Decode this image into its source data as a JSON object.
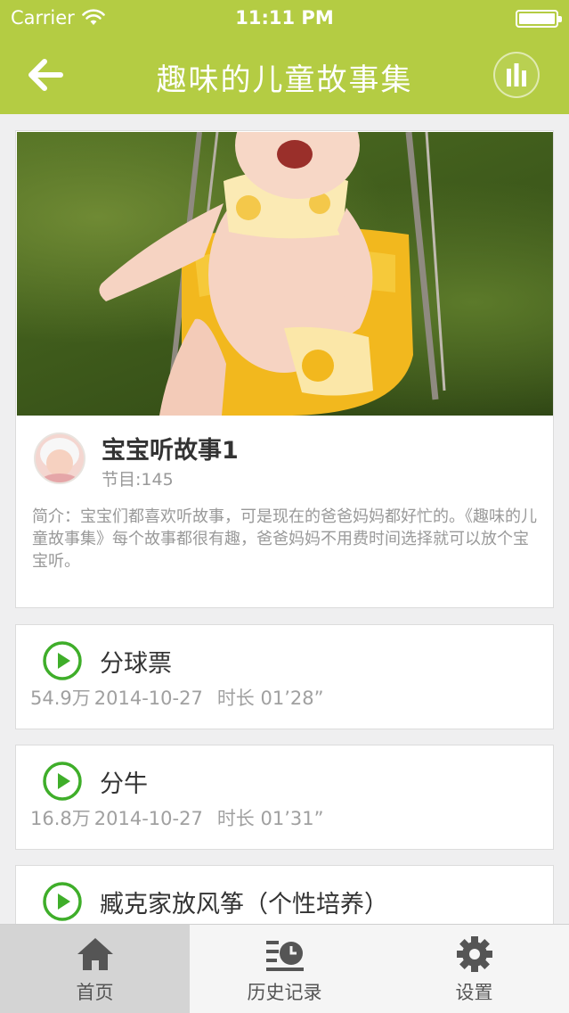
{
  "status_bar": {
    "carrier": "Carrier",
    "time": "11:11 PM"
  },
  "nav": {
    "title": "趣味的儿童故事集",
    "back_icon": "arrow-left-icon",
    "right_icon": "equalizer-icon"
  },
  "album": {
    "name": "宝宝听故事1",
    "episode_count": "节目:145",
    "description": "简介：宝宝们都喜欢听故事，可是现在的爸爸妈妈都好忙的。《趣味的儿童故事集》每个故事都很有趣，爸爸妈妈不用费时间选择就可以放个宝宝听。"
  },
  "episodes": [
    {
      "title": "分球票",
      "plays": "54.9万",
      "date": "2014-10-27",
      "duration": "时长 01’28”"
    },
    {
      "title": "分牛",
      "plays": "16.8万",
      "date": "2014-10-27",
      "duration": "时长 01’31”"
    },
    {
      "title": "臧克家放风筝（个性培养）",
      "plays": "",
      "date": "",
      "duration": ""
    }
  ],
  "tabs": [
    {
      "label": "首页",
      "icon": "home-icon",
      "active": true
    },
    {
      "label": "历史记录",
      "icon": "history-icon",
      "active": false
    },
    {
      "label": "设置",
      "icon": "gear-icon",
      "active": false
    }
  ],
  "colors": {
    "accent": "#b4cc43",
    "play_green": "#3fae2a",
    "background": "#efeff0"
  }
}
